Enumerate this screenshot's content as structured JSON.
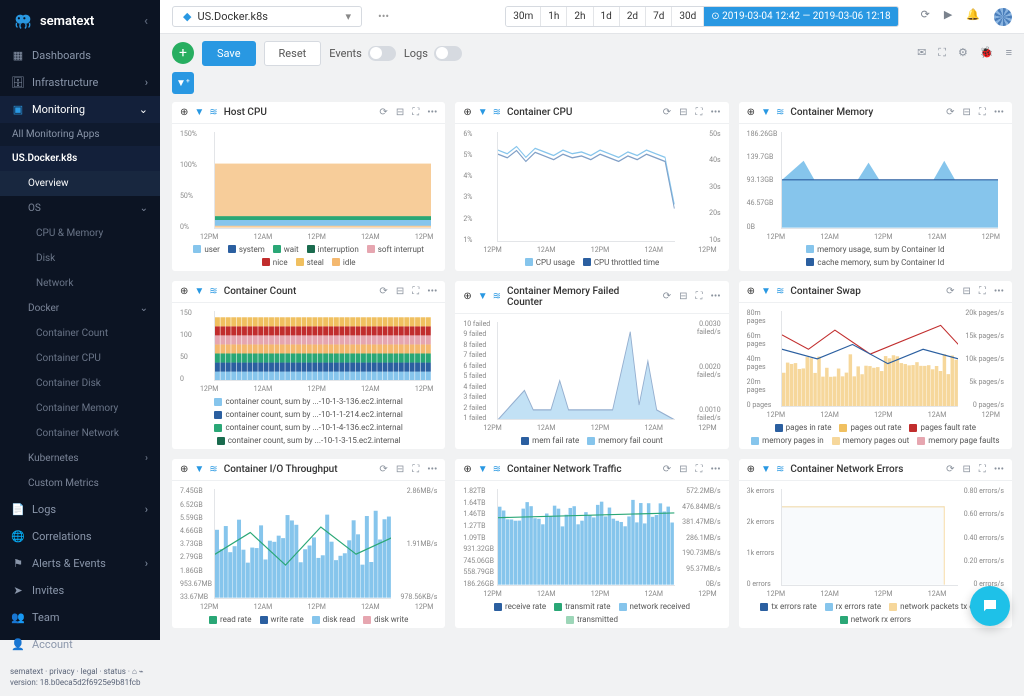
{
  "brand": "sematext",
  "selector": {
    "name": "US.Docker.k8s",
    "ellipsis": "•••"
  },
  "time_ranges": [
    "30m",
    "1h",
    "2h",
    "1d",
    "2d",
    "7d",
    "30d"
  ],
  "time_custom": "⊙ 2019-03-04 12:42 — 2019-03-06 12:18",
  "nav": {
    "dashboards": "Dashboards",
    "infrastructure": "Infrastructure",
    "monitoring": "Monitoring",
    "all_apps": "All Monitoring Apps",
    "app": "US.Docker.k8s",
    "overview": "Overview",
    "os": "OS",
    "cpu_memory": "CPU & Memory",
    "disk": "Disk",
    "network": "Network",
    "docker": "Docker",
    "container_count": "Container Count",
    "container_cpu": "Container CPU",
    "container_disk": "Container Disk",
    "container_memory": "Container Memory",
    "container_network": "Container Network",
    "kubernetes": "Kubernetes",
    "custom_metrics": "Custom Metrics",
    "logs": "Logs",
    "correlations": "Correlations",
    "alerts_events": "Alerts & Events",
    "invites": "Invites",
    "team": "Team",
    "account": "Account"
  },
  "footer": {
    "links": "sematext · privacy · legal · status · ⌂ ⌁",
    "version": "version: 18.b0eca5d2f6925e9b81fcb"
  },
  "buttons": {
    "save": "Save",
    "reset": "Reset",
    "events": "Events",
    "logs": "Logs"
  },
  "cards": {
    "host_cpu": "Host CPU",
    "container_cpu": "Container CPU",
    "container_memory": "Container Memory",
    "container_count": "Container Count",
    "mem_failed": "Container Memory Failed Counter",
    "container_swap": "Container Swap",
    "io_throughput": "Container I/O Throughput",
    "net_traffic": "Container Network Traffic",
    "net_errors": "Container Network Errors"
  },
  "chart_data": [
    {
      "id": "host_cpu",
      "type": "area",
      "ylim": [
        0,
        150
      ],
      "yticks": [
        "150%",
        "100%",
        "50%",
        "0%"
      ],
      "x": [
        "12PM",
        "12AM",
        "12PM",
        "12AM",
        "12PM"
      ],
      "series": [
        {
          "name": "user",
          "color": "#86c5ec"
        },
        {
          "name": "system",
          "color": "#2b5fa0"
        },
        {
          "name": "wait",
          "color": "#2aa776"
        },
        {
          "name": "interruption",
          "color": "#1a6b4e"
        },
        {
          "name": "soft interrupt",
          "color": "#e6a6b0"
        },
        {
          "name": "nice",
          "color": "#c12d2d"
        },
        {
          "name": "steal",
          "color": "#f0c060"
        },
        {
          "name": "idle",
          "color": "#f4b86f"
        }
      ],
      "total_band": 22
    },
    {
      "id": "container_cpu",
      "type": "line",
      "ylim": [
        0,
        6
      ],
      "yticks": [
        "6%",
        "5%",
        "4%",
        "3%",
        "2%",
        "1%"
      ],
      "y2ticks": [
        "50s",
        "40s",
        "30s",
        "20s",
        "10s"
      ],
      "x": [
        "12PM",
        "12AM",
        "12PM",
        "12AM",
        "12PM"
      ],
      "series": [
        {
          "name": "CPU usage",
          "color": "#86c5ec"
        },
        {
          "name": "CPU throttled time",
          "color": "#2b5fa0"
        }
      ],
      "values": [
        5.0,
        4.8,
        5.2,
        4.6,
        5.1,
        4.9,
        4.7,
        5.0,
        4.8,
        4.9,
        4.7,
        5.0,
        4.8,
        4.6,
        4.9,
        4.7,
        5.0,
        4.8,
        4.6,
        2.0
      ]
    },
    {
      "id": "container_memory",
      "type": "area",
      "yticks": [
        "186.26GB",
        "139.7GB",
        "93.13GB",
        "46.57GB",
        "0B"
      ],
      "x": [
        "12PM",
        "12AM",
        "12PM",
        "12AM",
        "12PM"
      ],
      "series": [
        {
          "name": "memory usage, sum by Container Id",
          "color": "#86c5ec"
        },
        {
          "name": "cache memory, sum by Container Id",
          "color": "#2b5fa0"
        }
      ],
      "baseline": 93,
      "spikes": [
        130,
        128,
        135,
        126
      ]
    },
    {
      "id": "container_count",
      "type": "stacked-bar",
      "yticks": [
        "150",
        "100",
        "50",
        "0"
      ],
      "x": [
        "12PM",
        "12AM",
        "12PM",
        "12AM",
        "12PM"
      ],
      "series": [
        {
          "name": "container count, sum by ...-10-1-3-136.ec2.internal",
          "color": "#86c5ec"
        },
        {
          "name": "container count, sum by ...-10-1-1-214.ec2.internal",
          "color": "#2b5fa0"
        },
        {
          "name": "container count, sum by ...-10-1-4-136.ec2.internal",
          "color": "#2aa776"
        },
        {
          "name": "container count, sum by ...-10-1-3-15.ec2.internal",
          "color": "#1a6b4e"
        }
      ],
      "stacked_total": 145,
      "bars": 40
    },
    {
      "id": "mem_failed",
      "type": "line",
      "yticks": [
        "10 failed",
        "9 failed",
        "8 failed",
        "7 failed",
        "6 failed",
        "5 failed",
        "4 failed",
        "3 failed",
        "2 failed",
        "1 failed"
      ],
      "y2ticks": [
        "0.0030 failed/s",
        "0.0020 failed/s",
        "0.0010 failed/s"
      ],
      "x": [
        "12PM",
        "12AM",
        "12PM",
        "12AM",
        "12PM"
      ],
      "series": [
        {
          "name": "mem fail rate",
          "color": "#2b5fa0"
        },
        {
          "name": "memory fail count",
          "color": "#86c5ec"
        }
      ]
    },
    {
      "id": "container_swap",
      "type": "line",
      "yticks": [
        "80m pages",
        "60m pages",
        "40m pages",
        "20m pages",
        "0 pages"
      ],
      "y2ticks": [
        "20k pages/s",
        "15k pages/s",
        "10k pages/s",
        "5k pages/s",
        "0 pages/s"
      ],
      "x": [
        "12PM",
        "12AM",
        "12PM",
        "12AM",
        "12PM"
      ],
      "series": [
        {
          "name": "pages in rate",
          "color": "#2b5fa0"
        },
        {
          "name": "pages out rate",
          "color": "#f0c060"
        },
        {
          "name": "pages fault rate",
          "color": "#c12d2d"
        },
        {
          "name": "memory pages in",
          "color": "#86c5ec"
        },
        {
          "name": "memory pages out",
          "color": "#f6d79b"
        },
        {
          "name": "memory page faults",
          "color": "#e6a6b0"
        }
      ]
    },
    {
      "id": "io_throughput",
      "type": "bar",
      "yticks": [
        "7.45GB",
        "6.52GB",
        "5.59GB",
        "4.66GB",
        "3.73GB",
        "2.79GB",
        "1.86GB",
        "953.67MB",
        "33.67MB"
      ],
      "y2ticks": [
        "2.86MB/s",
        "1.91MB/s",
        "978.56KB/s"
      ],
      "x": [
        "12PM",
        "12AM",
        "12PM",
        "12AM",
        "12PM"
      ],
      "series": [
        {
          "name": "read rate",
          "color": "#2aa776"
        },
        {
          "name": "write rate",
          "color": "#2b5fa0"
        },
        {
          "name": "disk read",
          "color": "#86c5ec"
        },
        {
          "name": "disk write",
          "color": "#e6a6b0"
        }
      ]
    },
    {
      "id": "net_traffic",
      "type": "bar",
      "yticks": [
        "1.82TB",
        "1.64TB",
        "1.46TB",
        "1.27TB",
        "1.09TB",
        "931.32GB",
        "745.06GB",
        "558.79GB",
        "186.26GB"
      ],
      "y2ticks": [
        "572.2MB/s",
        "476.84MB/s",
        "381.47MB/s",
        "286.1MB/s",
        "190.73MB/s",
        "95.37MB/s",
        "0B/s"
      ],
      "x": [
        "12PM",
        "12AM",
        "12PM",
        "12AM",
        "12PM"
      ],
      "series": [
        {
          "name": "receive rate",
          "color": "#2b5fa0"
        },
        {
          "name": "transmit rate",
          "color": "#2aa776"
        },
        {
          "name": "network received",
          "color": "#86c5ec"
        },
        {
          "name": "transmitted",
          "color": "#9dd6b8"
        }
      ]
    },
    {
      "id": "net_errors",
      "type": "line",
      "yticks": [
        "3k errors",
        "2k errors",
        "1k errors",
        "0 errors"
      ],
      "y2ticks": [
        "0.80 errors/s",
        "0.60 errors/s",
        "0.40 errors/s",
        "0.20 errors/s",
        "0 errors/s"
      ],
      "x": [
        "12PM",
        "12AM",
        "12PM",
        "12AM",
        "12PM"
      ],
      "series": [
        {
          "name": "tx errors rate",
          "color": "#2b5fa0"
        },
        {
          "name": "rx errors rate",
          "color": "#86c5ec"
        },
        {
          "name": "network packets tx errors",
          "color": "#f6d79b"
        },
        {
          "name": "network rx errors",
          "color": "#2aa776"
        }
      ]
    }
  ],
  "xaxis_labels": [
    "12PM",
    "12AM",
    "12PM",
    "12AM",
    "12PM"
  ]
}
